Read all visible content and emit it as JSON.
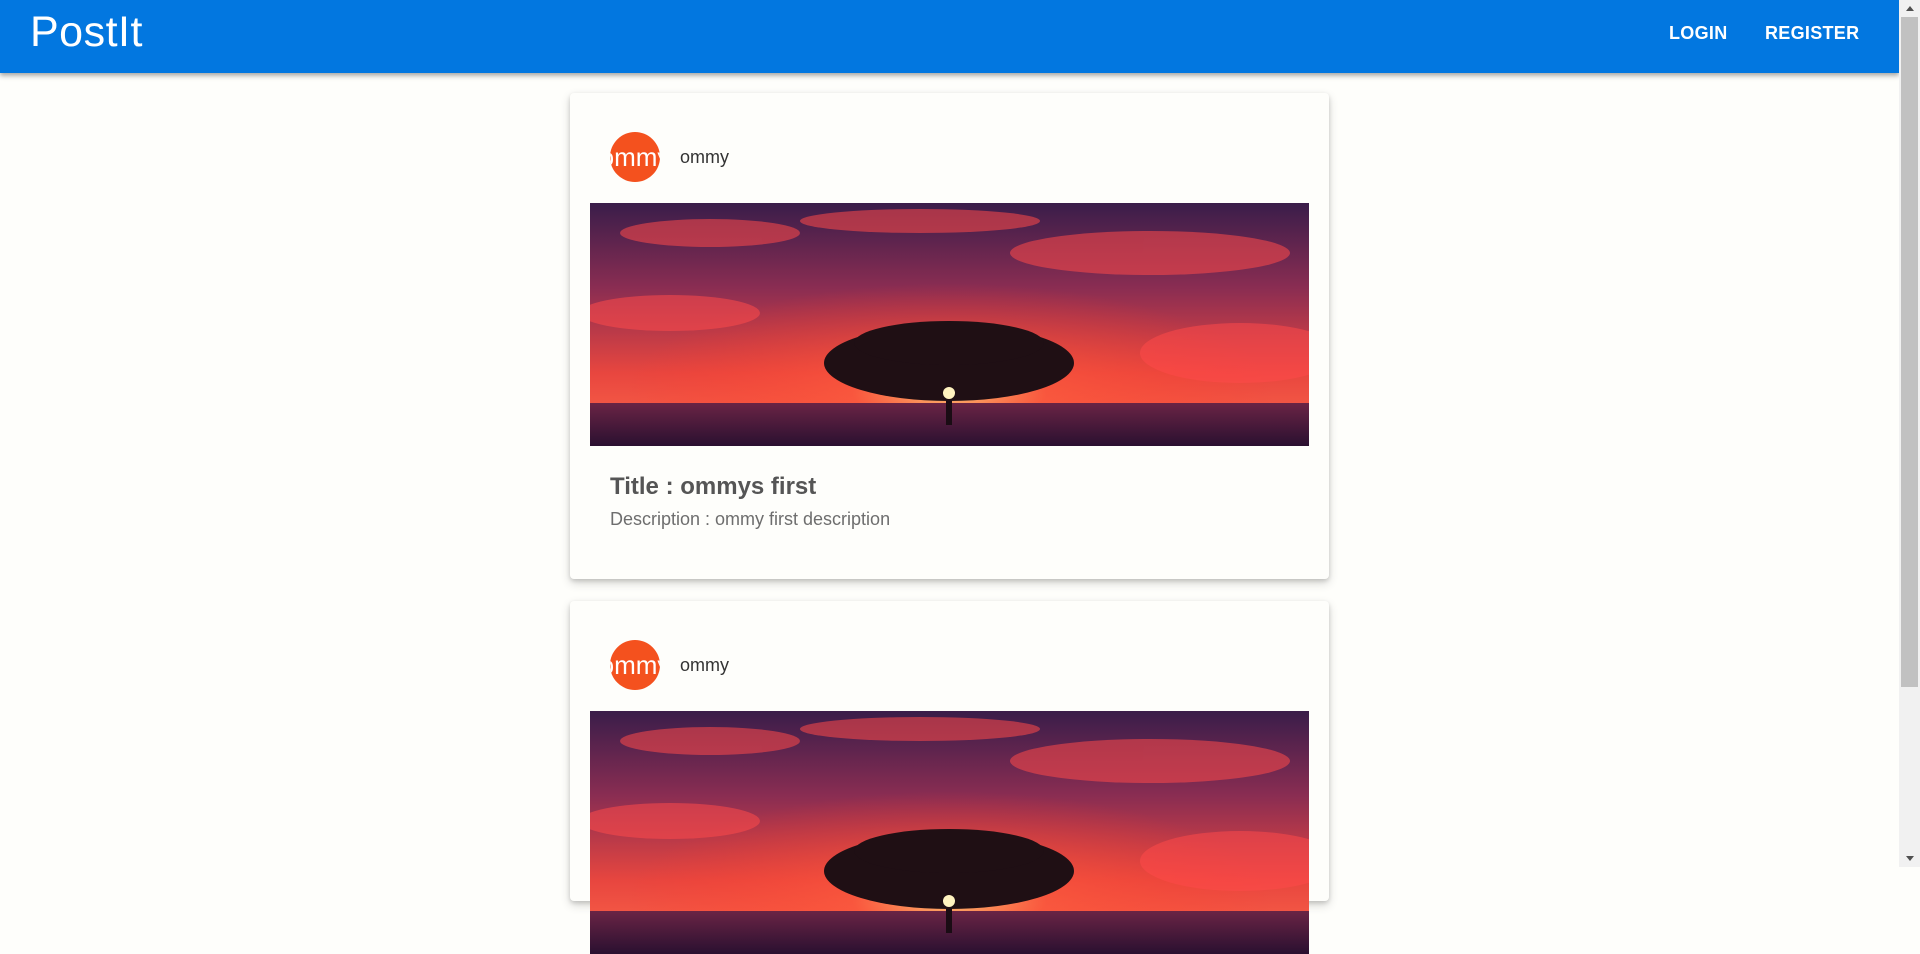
{
  "app": {
    "title": "PostIt"
  },
  "nav": {
    "login_label": "LOGIN",
    "register_label": "REGISTER"
  },
  "colors": {
    "primary": "#0277e0",
    "avatar": "#f4511e",
    "background": "#fefefb"
  },
  "posts": [
    {
      "author": "ommy",
      "avatar_text": "ommy",
      "image": "sunset-tree-image",
      "title": "Title : ommys first",
      "description": "Description : ommy first description"
    },
    {
      "author": "ommy",
      "avatar_text": "ommy",
      "image": "sunset-tree-image"
    }
  ]
}
